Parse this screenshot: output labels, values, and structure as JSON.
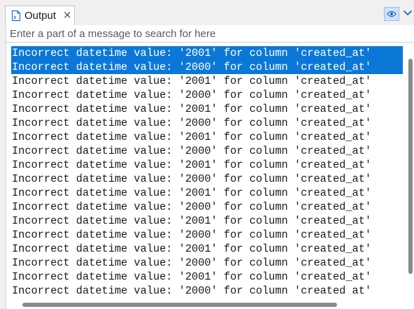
{
  "tab": {
    "label": "Output",
    "close_glyph": "×",
    "icon": "output-document-icon"
  },
  "toolbar": {
    "visibility_icon": "eye-icon",
    "menu_icon": "chevron-down-icon"
  },
  "search": {
    "placeholder": "Enter a part of a message to search for here",
    "value": ""
  },
  "colors": {
    "selection": "#0b78d7",
    "view_button": "#cfe2f7"
  },
  "log": {
    "lines": [
      {
        "text": "Incorrect datetime value: '2001' for column 'created_at'",
        "selected": true
      },
      {
        "text": "Incorrect datetime value: '2000' for column 'created_at'",
        "selected": true
      },
      {
        "text": "Incorrect datetime value: '2001' for column 'created_at'",
        "selected": false
      },
      {
        "text": "Incorrect datetime value: '2000' for column 'created_at'",
        "selected": false
      },
      {
        "text": "Incorrect datetime value: '2001' for column 'created_at'",
        "selected": false
      },
      {
        "text": "Incorrect datetime value: '2000' for column 'created_at'",
        "selected": false
      },
      {
        "text": "Incorrect datetime value: '2001' for column 'created_at'",
        "selected": false
      },
      {
        "text": "Incorrect datetime value: '2000' for column 'created_at'",
        "selected": false
      },
      {
        "text": "Incorrect datetime value: '2001' for column 'created_at'",
        "selected": false
      },
      {
        "text": "Incorrect datetime value: '2000' for column 'created_at'",
        "selected": false
      },
      {
        "text": "Incorrect datetime value: '2001' for column 'created_at'",
        "selected": false
      },
      {
        "text": "Incorrect datetime value: '2000' for column 'created_at'",
        "selected": false
      },
      {
        "text": "Incorrect datetime value: '2001' for column 'created_at'",
        "selected": false
      },
      {
        "text": "Incorrect datetime value: '2000' for column 'created_at'",
        "selected": false
      },
      {
        "text": "Incorrect datetime value: '2001' for column 'created_at'",
        "selected": false
      },
      {
        "text": "Incorrect datetime value: '2000' for column 'created_at'",
        "selected": false
      },
      {
        "text": "Incorrect datetime value: '2001' for column 'created_at'",
        "selected": false
      },
      {
        "text": "Incorrect datetime value: '2000' for column 'created_at'",
        "selected": false
      }
    ]
  }
}
